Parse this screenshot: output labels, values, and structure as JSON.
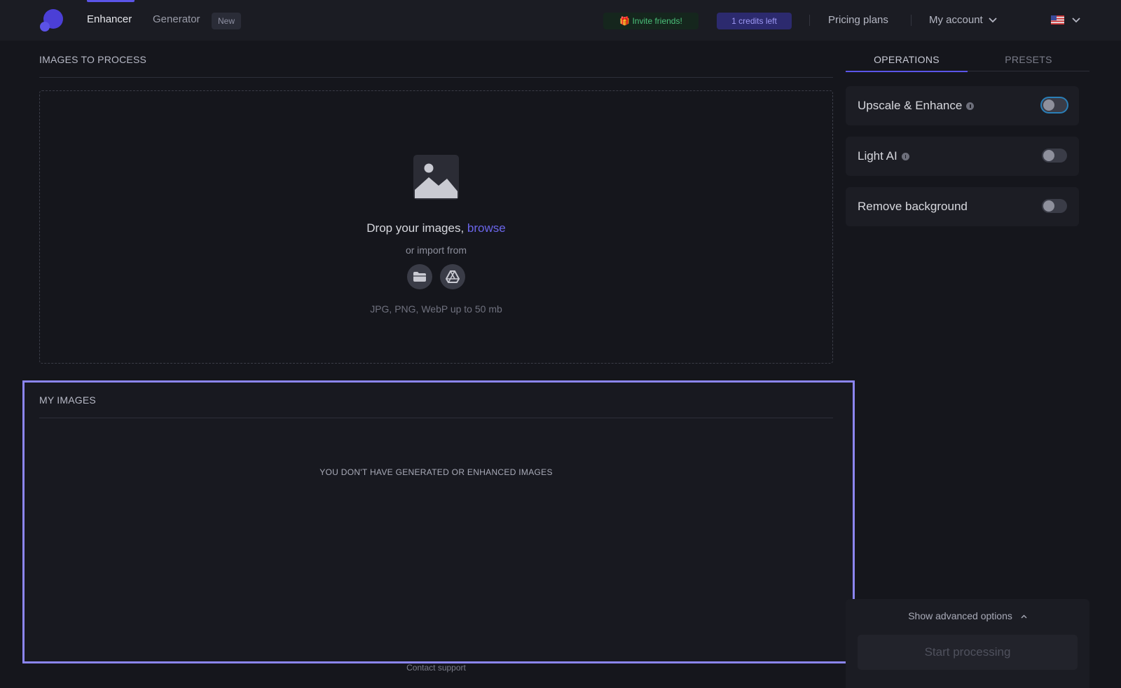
{
  "header": {
    "nav": {
      "enhancer": "Enhancer",
      "generator": "Generator",
      "new_badge": "New"
    },
    "invite": "🎁 Invite friends!",
    "credits": "1 credits left",
    "pricing": "Pricing plans",
    "account": "My account"
  },
  "upload": {
    "title": "IMAGES TO PROCESS",
    "drop_prefix": "Drop your images, ",
    "browse": "browse",
    "import_from": "or import from",
    "formats": "JPG, PNG, WebP up to 50 mb"
  },
  "my_images": {
    "title": "MY IMAGES",
    "empty": "YOU DON'T HAVE GENERATED OR ENHANCED IMAGES"
  },
  "footer": {
    "contact": "Contact support"
  },
  "sidebar": {
    "tabs": {
      "operations": "OPERATIONS",
      "presets": "PRESETS"
    },
    "operations": [
      {
        "label": "Upscale & Enhance",
        "info": true,
        "enabled": false
      },
      {
        "label": "Light AI",
        "info": true,
        "enabled": false
      },
      {
        "label": "Remove background",
        "info": false,
        "enabled": false
      }
    ],
    "advanced": "Show advanced options",
    "start": "Start processing"
  },
  "colors": {
    "accent": "#5b55e8",
    "link": "#6b66ea",
    "highlight_border": "#8b85f0"
  }
}
